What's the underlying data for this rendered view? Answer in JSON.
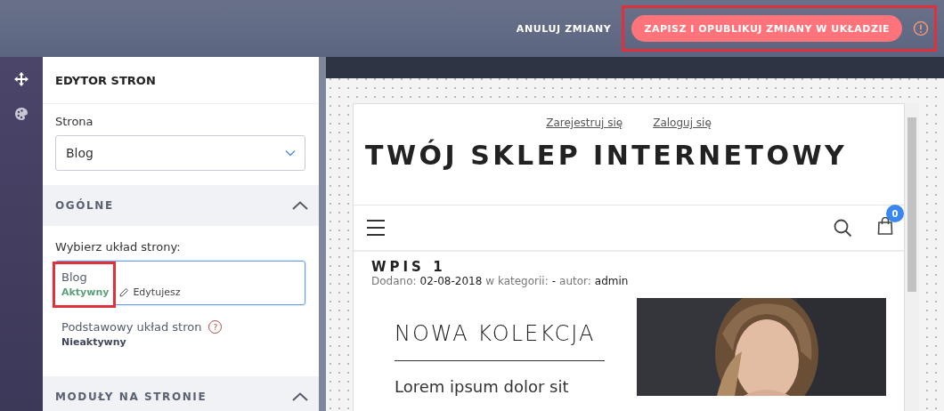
{
  "top_bar": {
    "cancel_button": "ANULUJ ZMIANY",
    "publish_button": {
      "label": "ZAPISZ I OPUBLIKUJ ZMIANY W UKŁADZIE",
      "highlighted": true
    }
  },
  "panel": {
    "title": "EDYTOR STRON",
    "page_field": {
      "label": "Strona",
      "value": "Blog"
    },
    "sections": [
      {
        "title": "OGÓLNE",
        "expanded": true,
        "layout_label": "Wybierz układ strony:",
        "layouts": [
          {
            "name": "Blog",
            "status": "Aktywny",
            "active": true,
            "selected": true,
            "highlighted": true,
            "edit_label": "Edytujesz"
          },
          {
            "name": "Podstawowy układ stron",
            "status": "Nieaktywny",
            "active": false,
            "selected": false,
            "highlighted": false,
            "help": "?"
          }
        ]
      },
      {
        "title": "MODUŁY NA STRONIE",
        "expanded": true
      }
    ]
  },
  "preview": {
    "links": [
      "Zarejestruj się",
      "Zaloguj się"
    ],
    "store_title": "TWÓJ SKLEP INTERNETOWY",
    "cart_count": "0",
    "post": {
      "title": "WPIS 1",
      "meta": [
        {
          "text": "Dodano:",
          "strong": false
        },
        {
          "text": "02-08-2018",
          "strong": true
        },
        {
          "text": "w kategorii:",
          "strong": false
        },
        {
          "text": "-",
          "strong": true
        },
        {
          "text": "autor:",
          "strong": false
        },
        {
          "text": "admin",
          "strong": true
        }
      ]
    },
    "banner": {
      "heading": "NOWA KOLEKCJA",
      "text": "Lorem ipsum dolor sit",
      "kind": "picture"
    }
  }
}
